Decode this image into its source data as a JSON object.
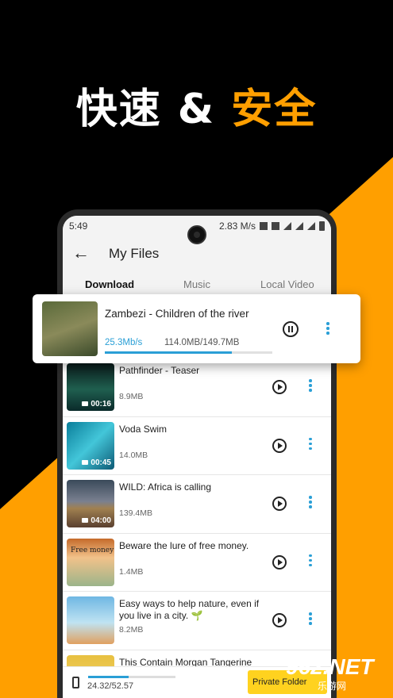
{
  "headline": {
    "white": "快速 & ",
    "orange": "安全"
  },
  "colors": {
    "accent": "#ff9f00",
    "link_blue": "#2a9fd6",
    "private_btn": "#ffd21f"
  },
  "statusbar": {
    "time": "5:49",
    "speed": "2.83 M/s"
  },
  "appbar": {
    "back_icon": "arrow-left-icon",
    "title": "My Files"
  },
  "tabs": [
    "Download",
    "Music",
    "Local Video"
  ],
  "active_download": {
    "title": "Zambezi - Children of the river",
    "speed": "25.3Mb/s",
    "progress_text": "114.0MB/149.7MB",
    "progress_fraction": 0.76
  },
  "files": [
    {
      "title": "Pathfinder - Teaser",
      "size": "8.9MB",
      "duration": "00:16"
    },
    {
      "title": "Voda Swim",
      "size": "14.0MB",
      "duration": "00:45"
    },
    {
      "title": "WILD: Africa is calling",
      "size": "139.4MB",
      "duration": "04:00"
    },
    {
      "title": "Beware the lure of free money.",
      "size": "1.4MB",
      "duration": "",
      "thumb_text": "Free money"
    },
    {
      "title": "Easy ways to help nature, even if you live in a city. 🌱",
      "size": "8.2MB",
      "duration": ""
    },
    {
      "title": "This Contain Morgan Tangerine",
      "size": "",
      "duration": ""
    }
  ],
  "bottom": {
    "storage": "24.32/52.57",
    "storage_fraction": 0.46,
    "private_folder": "Private Folder"
  },
  "watermark": {
    "top": "962.NET",
    "bottom": "乐游网"
  }
}
